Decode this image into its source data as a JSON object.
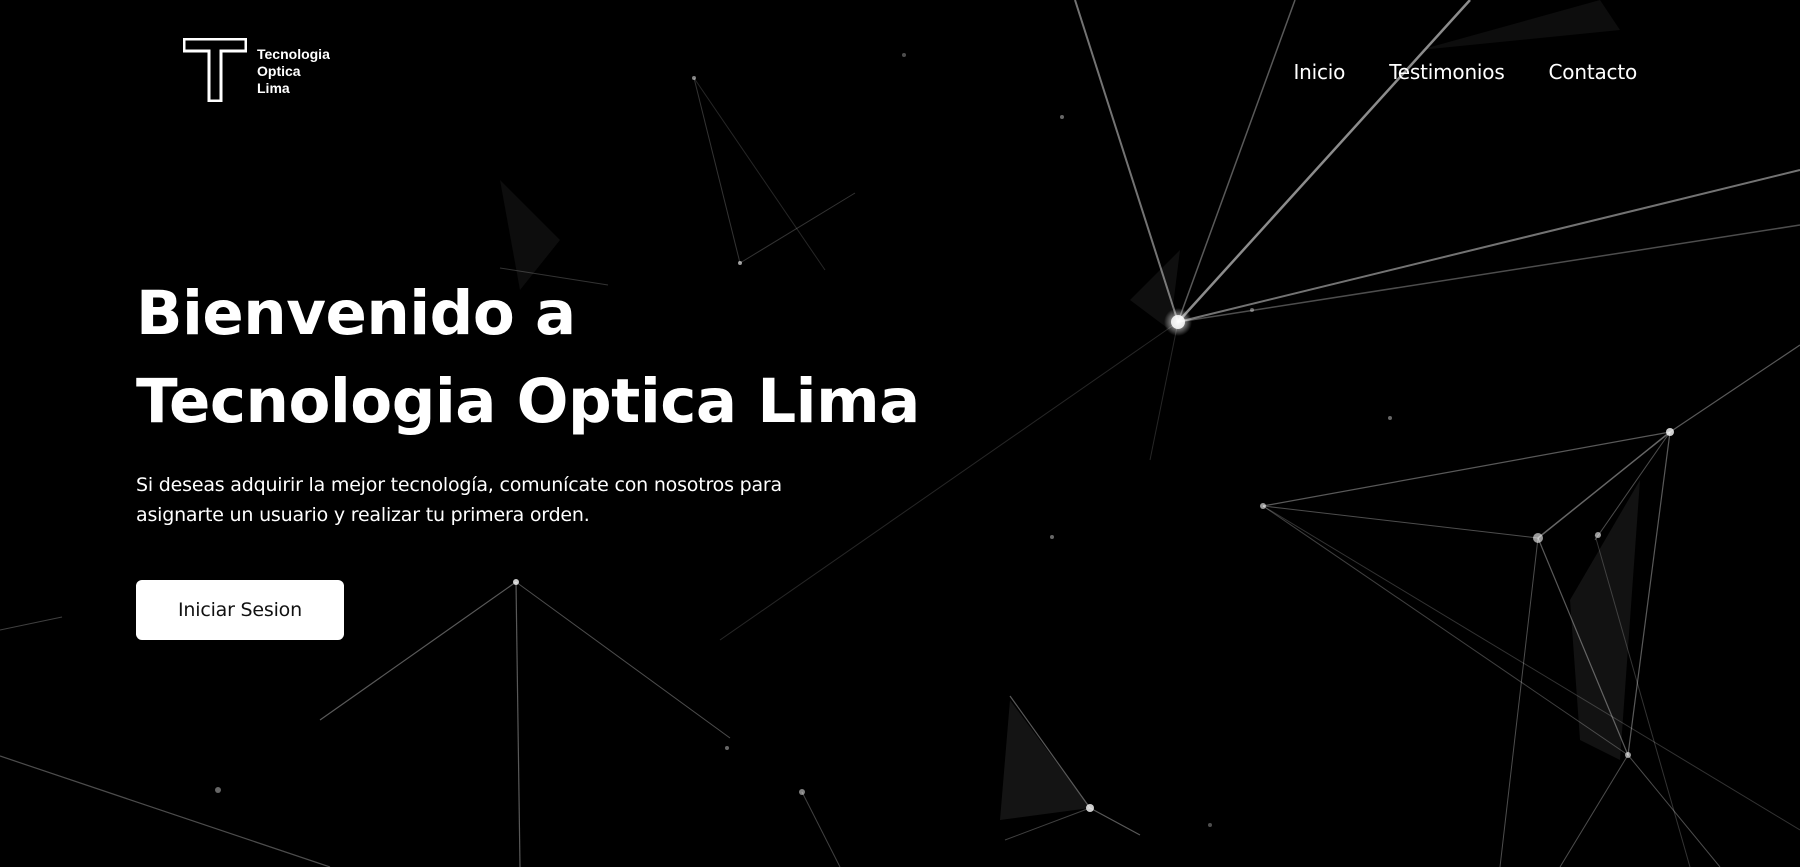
{
  "brand": {
    "logo_icon": "t-logo-icon",
    "name_lines": [
      "Tecnologia",
      "Optica",
      "Lima"
    ]
  },
  "nav": {
    "items": [
      {
        "label": "Inicio"
      },
      {
        "label": "Testimonios"
      },
      {
        "label": "Contacto"
      }
    ]
  },
  "hero": {
    "title_line1": "Bienvenido a",
    "title_line2": "Tecnologia Optica Lima",
    "description": "Si deseas adquirir la mejor tecnología, comunícate con nosotros para asignarte un usuario y realizar tu primera orden.",
    "cta_label": "Iniciar Sesion"
  },
  "colors": {
    "background": "#000000",
    "text": "#ffffff",
    "button_bg": "#ffffff",
    "button_text": "#111111"
  }
}
